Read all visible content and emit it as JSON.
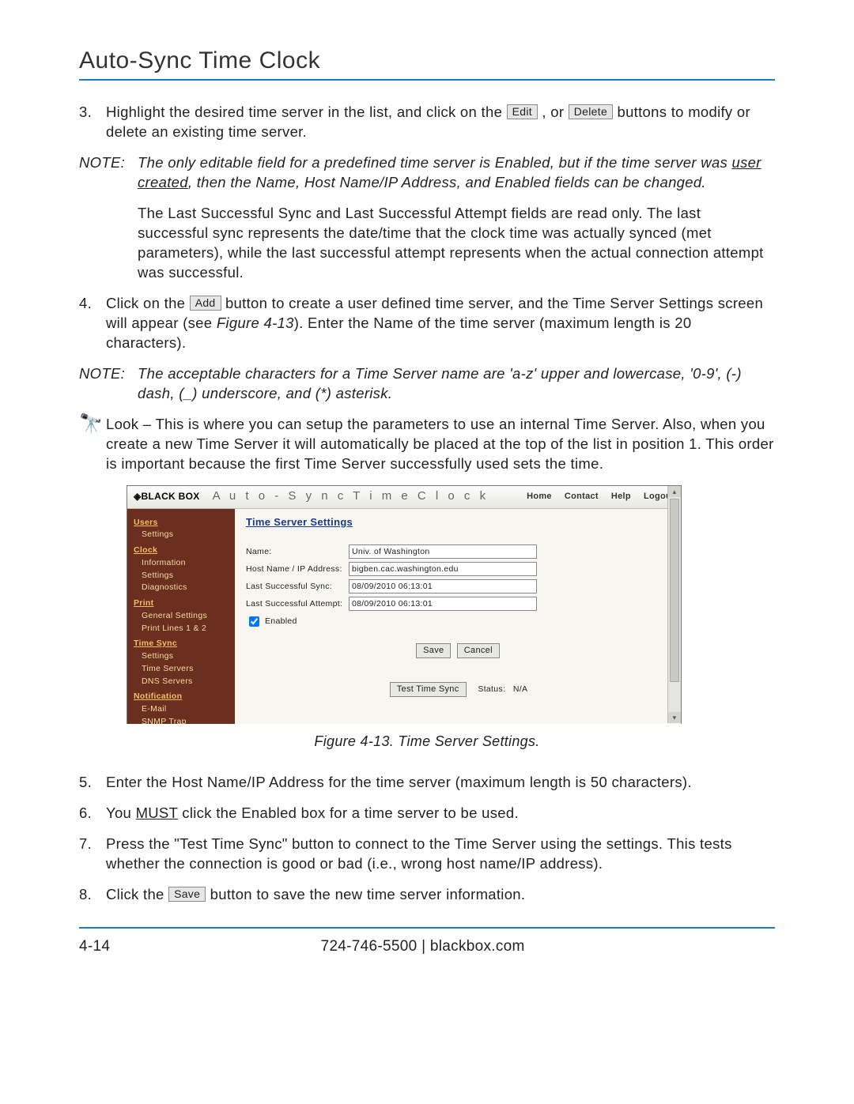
{
  "title": "Auto-Sync Time Clock",
  "step3": {
    "num": "3.",
    "t1": "Highlight the desired time server in the list, and click on the ",
    "btn_edit": "Edit",
    "t2": ", or ",
    "btn_delete": "Delete",
    "t3": " buttons to modify or delete an existing time server."
  },
  "note1": {
    "label": "NOTE:",
    "italic1": "The only editable field for a predefined time server is Enabled, but if the time server was ",
    "underlined": "user created",
    "italic2": ", then the Name, Host Name/IP Address, and Enabled fields can be changed.",
    "plain": "The Last Successful Sync and Last Successful Attempt fields are read only. The last successful sync represents the date/time that the clock time was actually synced (met parameters), while the last successful attempt represents when the actual connection attempt was successful."
  },
  "step4": {
    "num": "4.",
    "t1": "Click on the ",
    "btn_add": "Add",
    "t2": " button to create a user defined time server, and the Time Server Settings screen will appear (see ",
    "figref": "Figure 4-13",
    "t3": "). Enter the Name of the time server (maximum length is 20 characters)."
  },
  "note2": {
    "label": "NOTE:",
    "body": "The acceptable characters for a Time Server name are 'a-z' upper and lowercase, '0-9', (-) dash, (_) underscore, and (*) asterisk."
  },
  "look": {
    "body": "Look – This is where you can setup the parameters to use an internal Time Server. Also, when you create a new Time Server it will automatically be placed at the top of the list in position 1. This order is important because the first Time Server successfully used sets the time."
  },
  "fig": {
    "logo": "◈BLACK BOX",
    "apptitle": "A u t o - S y n c  T i m e  C l o c k",
    "nav": {
      "home": "Home",
      "contact": "Contact",
      "help": "Help",
      "logout": "Logout"
    },
    "side": {
      "users": "Users",
      "users_settings": "Settings",
      "clock": "Clock",
      "clock_info": "Information",
      "clock_settings": "Settings",
      "clock_diag": "Diagnostics",
      "print": "Print",
      "print_general": "General Settings",
      "print_lines": "Print Lines 1 & 2",
      "timesync": "Time Sync",
      "ts_settings": "Settings",
      "ts_servers": "Time Servers",
      "ts_dns": "DNS Servers",
      "notif": "Notification",
      "notif_email": "E-Mail",
      "notif_snmp": "SNMP Trap"
    },
    "main": {
      "heading": "Time Server Settings",
      "name_lbl": "Name:",
      "name_val": "Univ. of Washington",
      "host_lbl": "Host Name / IP Address:",
      "host_val": "bigben.cac.washington.edu",
      "sync_lbl": "Last Successful Sync:",
      "sync_val": "08/09/2010 06:13:01",
      "att_lbl": "Last Successful Attempt:",
      "att_val": "08/09/2010 06:13:01",
      "enabled_lbl": "Enabled",
      "save": "Save",
      "cancel": "Cancel",
      "test": "Test Time Sync",
      "status_lbl": "Status:",
      "status_val": "N/A"
    }
  },
  "caption": "Figure 4-13.  Time Server Settings.",
  "step5": {
    "num": "5.",
    "body": "Enter the Host Name/IP Address for the time server (maximum length is 50 characters)."
  },
  "step6": {
    "num": "6.",
    "t1": "You ",
    "must": "MUST",
    "t2": " click the Enabled box for a time server to be used."
  },
  "step7": {
    "num": "7.",
    "body": "Press the \"Test Time Sync\" button to connect to the Time Server using the settings. This tests whether the connection is good or bad (i.e., wrong host name/IP address)."
  },
  "step8": {
    "num": "8.",
    "t1": "Click the ",
    "btn_save": "Save",
    "t2": " button to save the new time server information."
  },
  "footer": {
    "page": "4-14",
    "contact": "724-746-5500   |   blackbox.com"
  }
}
